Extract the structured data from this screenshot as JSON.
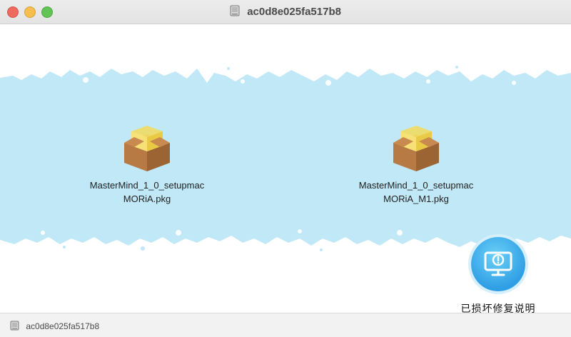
{
  "window": {
    "title": "ac0d8e025fa517b8",
    "traffic_colors": {
      "close": "#ee6a5f",
      "minimize": "#f5be4f",
      "maximize": "#61c454"
    },
    "title_icon": "disk-image-icon"
  },
  "content": {
    "background_accent": "#c1e8f7",
    "files": [
      {
        "name": "MasterMind_1_0_setupmac\nMORiA.pkg",
        "icon": "package-icon"
      },
      {
        "name": "MasterMind_1_0_setupmac\nMORiA_M1.pkg",
        "icon": "package-icon"
      }
    ],
    "repair": {
      "label": "已损坏修复说明",
      "icon": "monitor-warning-icon"
    }
  },
  "statusbar": {
    "path_label": "ac0d8e025fa517b8",
    "icon": "disk-image-icon"
  }
}
